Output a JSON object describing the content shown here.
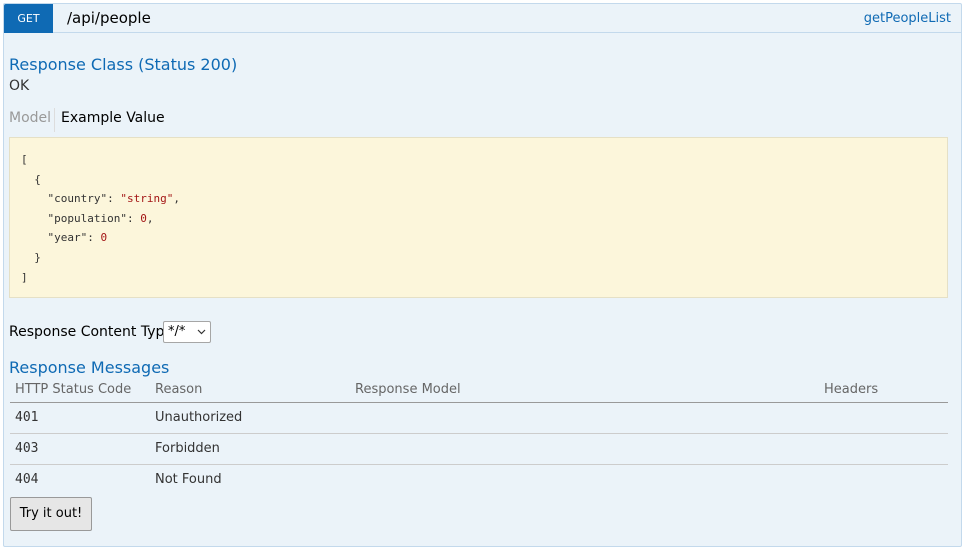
{
  "operation": {
    "method": "GET",
    "path": "/api/people",
    "nickname": "getPeopleList"
  },
  "response_class": {
    "heading": "Response Class (Status 200)",
    "status_text": "OK"
  },
  "tabs": {
    "model": "Model",
    "example_value": "Example Value",
    "active": "example_value"
  },
  "example": {
    "open_bracket": "[",
    "open_brace": "{",
    "fields": [
      {
        "key": "\"country\"",
        "value": "\"string\"",
        "trail": ","
      },
      {
        "key": "\"population\"",
        "value": "0",
        "trail": ","
      },
      {
        "key": "\"year\"",
        "value": "0",
        "trail": ""
      }
    ],
    "close_brace": "}",
    "close_bracket": "]"
  },
  "content_type": {
    "label": "Response Content Type",
    "selected": "*/*"
  },
  "response_messages": {
    "heading": "Response Messages",
    "columns": [
      "HTTP Status Code",
      "Reason",
      "Response Model",
      "Headers"
    ],
    "rows": [
      {
        "code": "401",
        "reason": "Unauthorized",
        "model": "",
        "headers": ""
      },
      {
        "code": "403",
        "reason": "Forbidden",
        "model": "",
        "headers": ""
      },
      {
        "code": "404",
        "reason": "Not Found",
        "model": "",
        "headers": ""
      }
    ]
  },
  "try_button": "Try it out!",
  "colors": {
    "method_bg": "#0f6ab4",
    "panel_bg": "#ebf3f9",
    "heading_blue": "#0f6ab4",
    "snippet_bg": "#fcf6db"
  }
}
